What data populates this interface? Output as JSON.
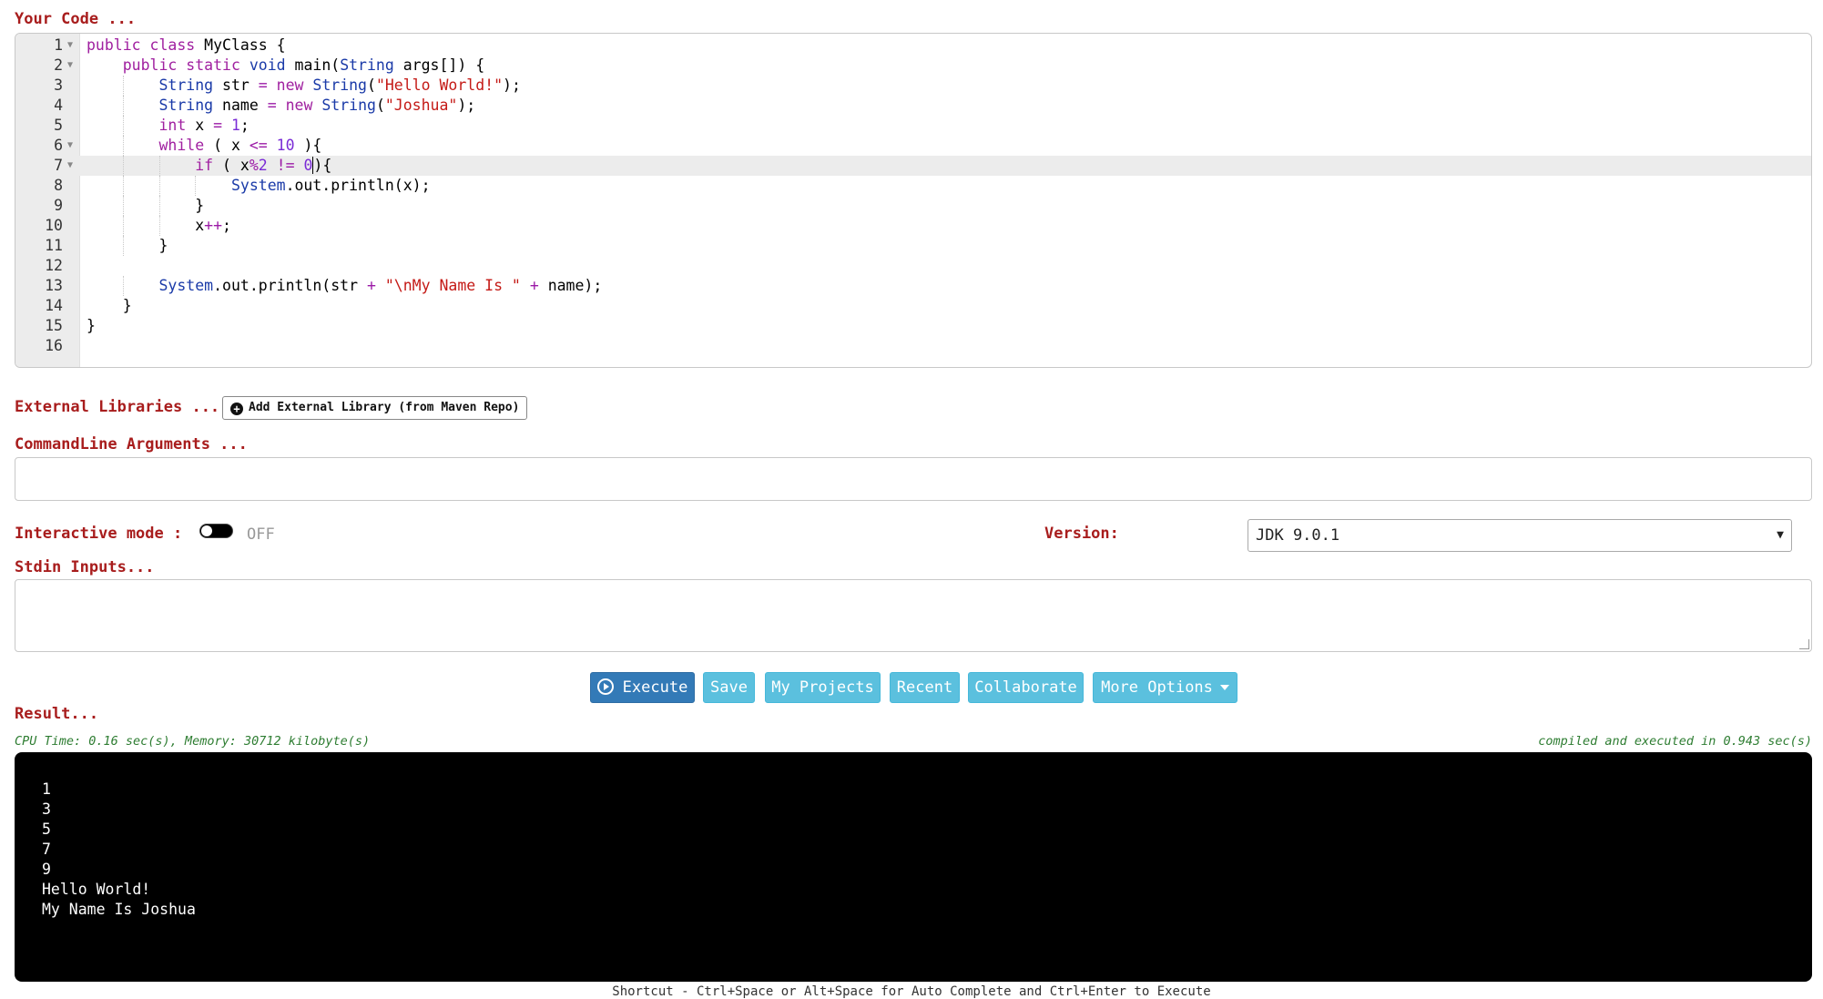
{
  "labels": {
    "your_code": "Your Code ...",
    "external_libraries": "External Libraries ...",
    "commandline_arguments": "CommandLine Arguments ...",
    "interactive_mode": "Interactive mode :",
    "version": "Version:",
    "stdin_inputs": "Stdin Inputs...",
    "result": "Result..."
  },
  "editor": {
    "active_line": 7,
    "lines": [
      {
        "n": "1",
        "fold": true,
        "indent": 0,
        "tokens": [
          [
            "kw",
            "public class "
          ],
          [
            "",
            "MyClass {"
          ]
        ]
      },
      {
        "n": "2",
        "fold": true,
        "indent": 1,
        "tokens": [
          [
            "kw",
            "public static "
          ],
          [
            "ty",
            "void"
          ],
          [
            "",
            " main("
          ],
          [
            "ty",
            "String"
          ],
          [
            "",
            " args[]) {"
          ]
        ]
      },
      {
        "n": "3",
        "fold": false,
        "indent": 2,
        "tokens": [
          [
            "ty",
            "String"
          ],
          [
            "",
            " str "
          ],
          [
            "op",
            "= "
          ],
          [
            "kw",
            "new "
          ],
          [
            "ty",
            "String"
          ],
          [
            "",
            "("
          ],
          [
            "st",
            "\"Hello World!\""
          ],
          [
            "",
            ");"
          ]
        ]
      },
      {
        "n": "4",
        "fold": false,
        "indent": 2,
        "tokens": [
          [
            "ty",
            "String"
          ],
          [
            "",
            " name "
          ],
          [
            "op",
            "= "
          ],
          [
            "kw",
            "new "
          ],
          [
            "ty",
            "String"
          ],
          [
            "",
            "("
          ],
          [
            "st",
            "\"Joshua\""
          ],
          [
            "",
            ");"
          ]
        ]
      },
      {
        "n": "5",
        "fold": false,
        "indent": 2,
        "tokens": [
          [
            "kw",
            "int"
          ],
          [
            "",
            " x "
          ],
          [
            "op",
            "= "
          ],
          [
            "nu",
            "1"
          ],
          [
            "",
            ";"
          ]
        ]
      },
      {
        "n": "6",
        "fold": true,
        "indent": 2,
        "tokens": [
          [
            "kw",
            "while"
          ],
          [
            "",
            " ( x "
          ],
          [
            "op",
            "<= "
          ],
          [
            "nu",
            "10"
          ],
          [
            "",
            " ){"
          ]
        ]
      },
      {
        "n": "7",
        "fold": true,
        "indent": 3,
        "tokens": [
          [
            "kw",
            "if"
          ],
          [
            "",
            " ( x"
          ],
          [
            "op",
            "%"
          ],
          [
            "nu",
            "2"
          ],
          [
            "op",
            " != "
          ],
          [
            "nu",
            "0"
          ],
          [
            "cursor",
            ")"
          ],
          [
            "",
            "{"
          ]
        ]
      },
      {
        "n": "8",
        "fold": false,
        "indent": 4,
        "tokens": [
          [
            "ty",
            "System"
          ],
          [
            "",
            ".out.println(x);"
          ]
        ]
      },
      {
        "n": "9",
        "fold": false,
        "indent": 3,
        "tokens": [
          [
            "",
            "}"
          ]
        ]
      },
      {
        "n": "10",
        "fold": false,
        "indent": 3,
        "tokens": [
          [
            "",
            "x"
          ],
          [
            "op",
            "++"
          ],
          [
            "",
            ";"
          ]
        ]
      },
      {
        "n": "11",
        "fold": false,
        "indent": 2,
        "tokens": [
          [
            "",
            "}"
          ]
        ]
      },
      {
        "n": "12",
        "fold": false,
        "indent": 0,
        "tokens": []
      },
      {
        "n": "13",
        "fold": false,
        "indent": 2,
        "tokens": [
          [
            "ty",
            "System"
          ],
          [
            "",
            ".out.println(str "
          ],
          [
            "op",
            "+ "
          ],
          [
            "st",
            "\"\\nMy Name Is \" "
          ],
          [
            "op",
            "+ "
          ],
          [
            "",
            "name);"
          ]
        ]
      },
      {
        "n": "14",
        "fold": false,
        "indent": 1,
        "tokens": [
          [
            "",
            "}"
          ]
        ]
      },
      {
        "n": "15",
        "fold": false,
        "indent": 0,
        "tokens": [
          [
            "",
            "}"
          ]
        ]
      },
      {
        "n": "16",
        "fold": false,
        "indent": 0,
        "tokens": []
      }
    ]
  },
  "external_library_button": "Add External Library (from Maven Repo)",
  "commandline_arguments_value": "",
  "interactive_mode_state": "OFF",
  "version_selected": "JDK 9.0.1",
  "stdin_value": "",
  "buttons": {
    "execute": "Execute",
    "save": "Save",
    "my_projects": "My Projects",
    "recent": "Recent",
    "collaborate": "Collaborate",
    "more_options": "More Options"
  },
  "result": {
    "cpu_stats": "CPU Time: 0.16 sec(s), Memory: 30712 kilobyte(s)",
    "compile_stats": "compiled and executed in 0.943 sec(s)",
    "output": [
      "1",
      "3",
      "5",
      "7",
      "9",
      "Hello World!",
      "My Name Is Joshua"
    ]
  },
  "shortcut_hint": "Shortcut - Ctrl+Space or Alt+Space for Auto Complete and Ctrl+Enter to Execute",
  "colors": {
    "label": "#a81d1d",
    "execute_button": "#337ab7",
    "secondary_button": "#5bc0de",
    "stats_text": "#2e7d32",
    "output_background": "#000000"
  }
}
